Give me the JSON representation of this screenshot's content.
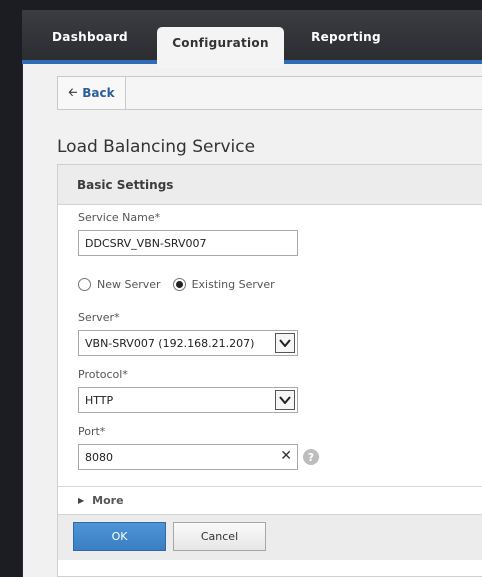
{
  "nav": {
    "tabs": [
      {
        "label": "Dashboard"
      },
      {
        "label": "Configuration"
      },
      {
        "label": "Reporting"
      }
    ]
  },
  "toolbar": {
    "back_label": "Back",
    "back_icon": "arrow-left-icon"
  },
  "page": {
    "title": "Load Balancing Service"
  },
  "panel": {
    "header": "Basic Settings",
    "service_name": {
      "label": "Service Name*",
      "value": "DDCSRV_VBN-SRV007"
    },
    "server_type": {
      "options": [
        {
          "label": "New Server",
          "checked": false
        },
        {
          "label": "Existing Server",
          "checked": true
        }
      ]
    },
    "server": {
      "label": "Server*",
      "selected": "VBN-SRV007 (192.168.21.207)"
    },
    "protocol": {
      "label": "Protocol*",
      "selected": "HTTP"
    },
    "port": {
      "label": "Port*",
      "value": "8080",
      "clear_glyph": "✕",
      "help_glyph": "?"
    },
    "more_label": "More"
  },
  "actions": {
    "ok_label": "OK",
    "cancel_label": "Cancel"
  },
  "colors": {
    "accent": "#2f6db6",
    "primary_button": "#3f86c9",
    "topbar": "#2d2f33"
  }
}
